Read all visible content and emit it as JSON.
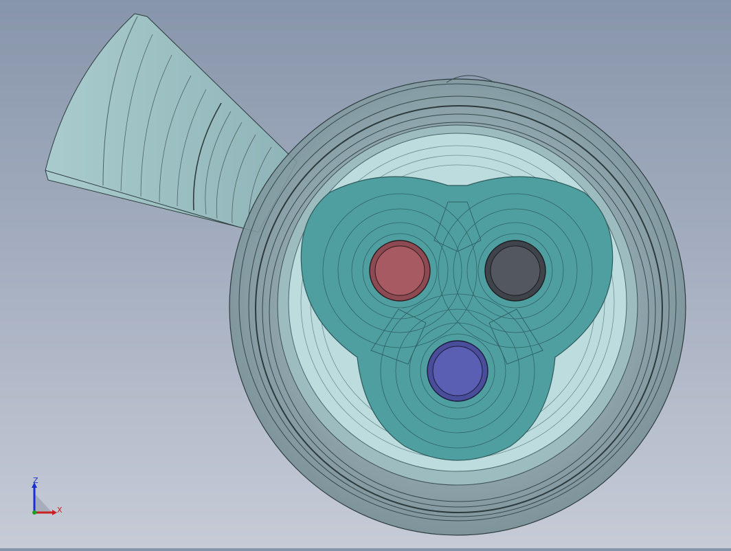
{
  "viewport": {
    "background_top": "#8795aa",
    "background_bottom": "#c6cbd6"
  },
  "model": {
    "outer_housing_color": "#9db7bb",
    "inner_disc_color": "#bcdcde",
    "insulation_color": "#4e9ea0",
    "conductors": [
      {
        "name": "red-conductor",
        "color": "#a85a62"
      },
      {
        "name": "black-conductor",
        "color": "#53575f"
      },
      {
        "name": "blue-conductor",
        "color": "#5b5fb4"
      }
    ]
  },
  "triad": {
    "z_label": "Z",
    "x_label": "X",
    "z_color": "#1b2fd0",
    "x_color": "#c81f1f",
    "y_color": "#1aa11a"
  }
}
